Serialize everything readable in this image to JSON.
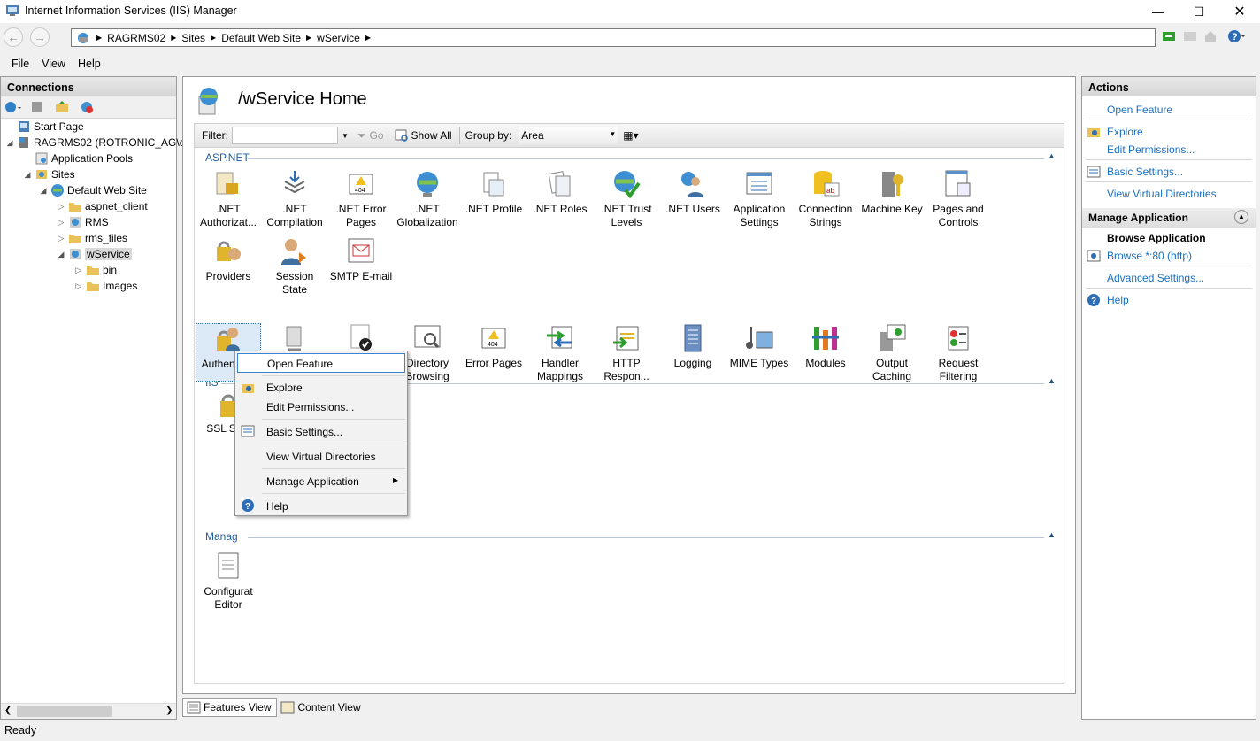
{
  "window": {
    "title": "Internet Information Services (IIS) Manager"
  },
  "address": {
    "crumbs": [
      "RAGRMS02",
      "Sites",
      "Default Web Site",
      "wService"
    ]
  },
  "menu": [
    "File",
    "View",
    "Help"
  ],
  "connections": {
    "header": "Connections",
    "tree": [
      {
        "label": "Start Page"
      },
      {
        "label": "RAGRMS02 (ROTRONIC_AG\\c"
      },
      {
        "label": "Application Pools"
      },
      {
        "label": "Sites"
      },
      {
        "label": "Default Web Site"
      },
      {
        "label": "aspnet_client"
      },
      {
        "label": "RMS"
      },
      {
        "label": "rms_files"
      },
      {
        "label": "wService"
      },
      {
        "label": "bin"
      },
      {
        "label": "Images"
      }
    ]
  },
  "main": {
    "title": "/wService Home",
    "filter_label": "Filter:",
    "go_label": "Go",
    "show_all_label": "Show All",
    "group_by_label": "Group by:",
    "group_by_value": "Area",
    "groups": {
      "aspnet": "ASP.NET",
      "iis": "IIS",
      "management": "Manag"
    },
    "aspnet_features": [
      ".NET Authorizat...",
      ".NET Compilation",
      ".NET Error Pages",
      ".NET Globalization",
      ".NET Profile",
      ".NET Roles",
      ".NET Trust Levels",
      ".NET Users",
      "Application Settings",
      "Connection Strings",
      "Machine Key",
      "Pages and Controls",
      "Providers",
      "Session State",
      "SMTP E-mail"
    ],
    "iis_features": [
      "Authenti on",
      "",
      "",
      "Directory Browsing",
      "Error Pages",
      "Handler Mappings",
      "HTTP Respon...",
      "Logging",
      "MIME Types",
      "Modules",
      "Output Caching",
      "Request Filtering",
      "SSL Setti"
    ],
    "management_features": [
      "Configurat Editor"
    ]
  },
  "bottom_tabs": {
    "features": "Features View",
    "content": "Content View"
  },
  "actions": {
    "header": "Actions",
    "open_feature": "Open Feature",
    "explore": "Explore",
    "edit_permissions": "Edit Permissions...",
    "basic_settings": "Basic Settings...",
    "view_virtual_directories": "View Virtual Directories",
    "manage_application": "Manage Application",
    "browse_application": "Browse Application",
    "browse_80": "Browse *:80 (http)",
    "advanced_settings": "Advanced Settings...",
    "help": "Help"
  },
  "context_menu": {
    "open_feature": "Open Feature",
    "explore": "Explore",
    "edit_permissions": "Edit Permissions...",
    "basic_settings": "Basic Settings...",
    "view_virtual_directories": "View Virtual Directories",
    "manage_application": "Manage Application",
    "help": "Help"
  },
  "status": {
    "text": "Ready"
  }
}
